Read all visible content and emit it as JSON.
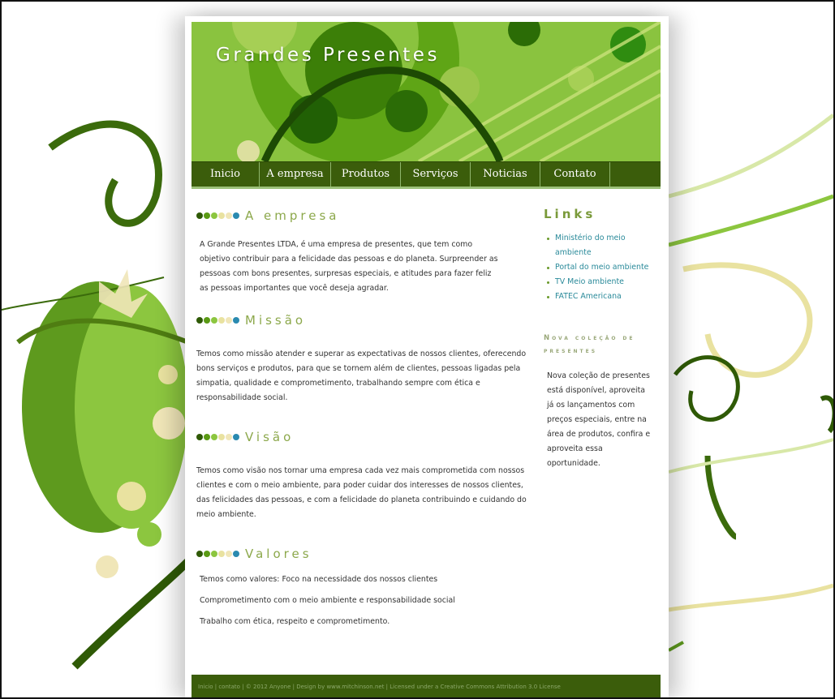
{
  "header": {
    "site_title": "Grandes Presentes"
  },
  "nav": {
    "items": [
      {
        "label": "Inicio"
      },
      {
        "label": "A empresa"
      },
      {
        "label": "Produtos"
      },
      {
        "label": "Serviços"
      },
      {
        "label": "Noticias"
      },
      {
        "label": "Contato"
      }
    ]
  },
  "sections": [
    {
      "title": "A empresa",
      "paragraphs": [
        "A Grande Presentes LTDA, é uma empresa de presentes, que tem como objetivo contribuir para a felicidade das pessoas e do planeta. Surpreender as pessoas com bons presentes, surpresas especiais, e atitudes para fazer feliz as pessoas importantes que você deseja agradar."
      ]
    },
    {
      "title": "Missão",
      "paragraphs": [
        "Temos como missão atender e superar as expectativas de nossos clientes, oferecendo bons serviços e produtos, para que se tornem além de clientes, pessoas ligadas pela simpatia, qualidade e comprometimento, trabalhando sempre com ética e responsabilidade social."
      ]
    },
    {
      "title": "Visão",
      "paragraphs": [
        "Temos como visão nos tornar uma empresa cada vez mais comprometida com nossos clientes e com o meio ambiente, para poder cuidar dos interesses de nossos clientes, das felicidades das pessoas, e com a felicidade do planeta contribuindo e cuidando do meio ambiente."
      ]
    },
    {
      "title": "Valores",
      "paragraphs": [
        "Temos como valores: Foco na necessidade dos nossos clientes",
        "Comprometimento com o meio ambiente e responsabilidade social",
        "Trabalho com ética, respeito e comprometimento."
      ]
    }
  ],
  "sidebar": {
    "links_title": "Links",
    "links": [
      {
        "label": "Ministério do meio ambiente"
      },
      {
        "label": "Portal do meio ambiente"
      },
      {
        "label": "TV Meio ambiente"
      },
      {
        "label": "FATEC Americana"
      }
    ],
    "nova_title": "Nova coleção de presentes",
    "nova_body": "Nova coleção de presentes está disponível, aproveita já os lançamentos com preços especiais, entre na área de produtos, confira e aproveita essa oportunidade."
  },
  "footer": {
    "text": "Inicio | contato | © 2012 Anyone | Design by www.mitchinson.net | Licensed under a Creative Commons Attribution 3.0 License"
  },
  "colors": {
    "nav_bg": "#3b5d0b",
    "accent_green": "#8ca84b",
    "link": "#2a8a9a",
    "dot_colors": [
      "#2f5a06",
      "#5a9a14",
      "#8cc63f",
      "#e9e2a0",
      "#f0e6b8",
      "#2a8ab0"
    ]
  }
}
